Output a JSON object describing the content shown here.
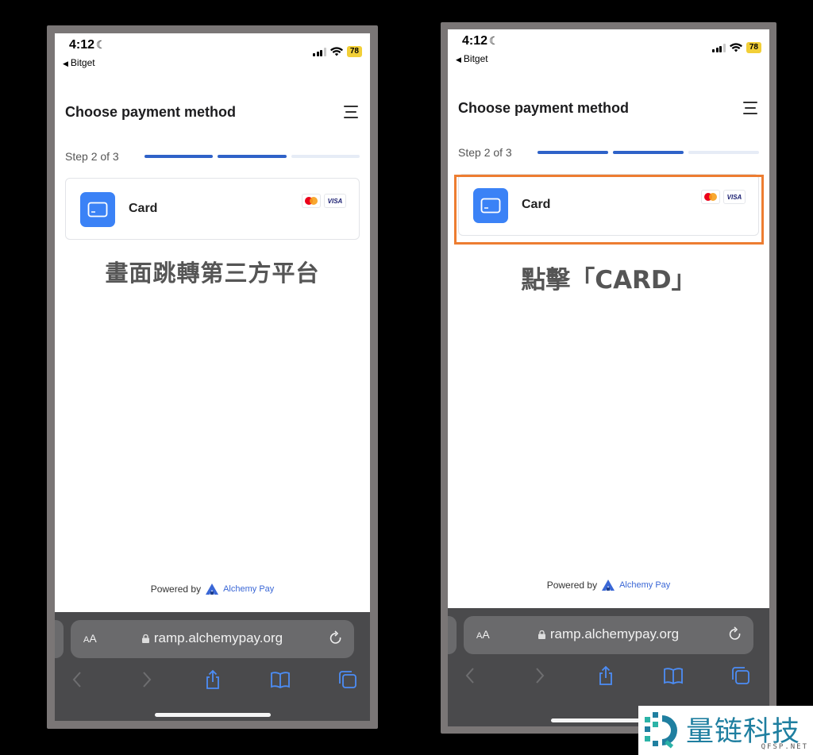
{
  "colors": {
    "accent_blue": "#2f62c8",
    "card_icon_bg": "#3b82f6",
    "highlight_orange": "#ed7d31",
    "battery_yellow": "#f2cf37",
    "watermark_teal": "#1f7fa0"
  },
  "status_bar": {
    "time": "4:12",
    "moon_glyph": "☾",
    "back_app": "Bitget",
    "battery": "78",
    "icons": [
      "moon-icon",
      "signal-icon",
      "wifi-icon",
      "battery-icon"
    ]
  },
  "page": {
    "title": "Choose payment method",
    "step_label": "Step 2 of 3",
    "progress": {
      "completed_steps": 2,
      "total_steps": 3
    },
    "payment_option": {
      "label": "Card",
      "brands": [
        "mastercard",
        "VISA"
      ]
    },
    "powered_by": "Powered by",
    "provider_name": "Alchemy Pay"
  },
  "browser": {
    "aa_label": "AA",
    "url": "ramp.alchemypay.org",
    "toolbar_icons": [
      "back-icon",
      "forward-icon",
      "share-icon",
      "bookmarks-icon",
      "tabs-icon"
    ]
  },
  "annotations": {
    "left_caption": "畫面跳轉第三方平台",
    "right_caption": "點擊「CARD」"
  },
  "watermark": {
    "text": "量链科技",
    "subtext": "QFSP.NET"
  }
}
